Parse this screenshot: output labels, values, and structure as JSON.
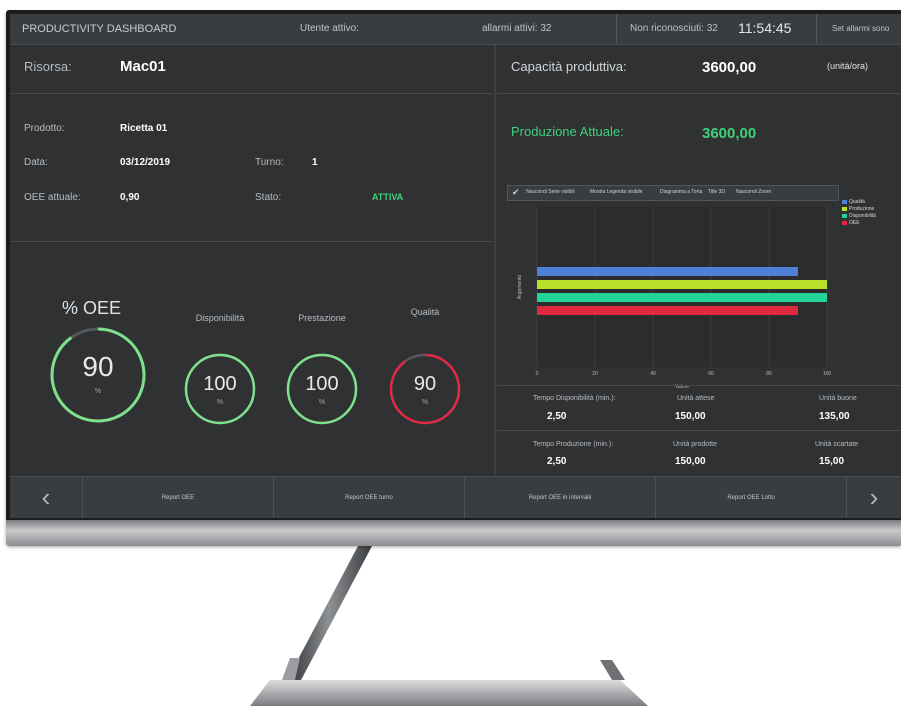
{
  "header": {
    "title": "PRODUCTIVITY DASHBOARD",
    "utente": "Utente attivo:",
    "allarmi": "allarmi attivi: 32",
    "non_riconosciuti": "Non riconosciuti: 32",
    "time": "11:54:45",
    "set": "Set allarmi sono"
  },
  "left": {
    "risorsa_label": "Risorsa:",
    "risorsa_value": "Mac01",
    "prodotto_label": "Prodotto:",
    "prodotto_value": "Ricetta 01",
    "data_label": "Data:",
    "data_value": "03/12/2019",
    "turno_label": "Turno:",
    "turno_value": "1",
    "oee_label": "OEE attuale:",
    "oee_value": "0,90",
    "stato_label": "Stato:",
    "stato_value": "ATTIVA"
  },
  "gauges": {
    "title": "% OEE",
    "oee": {
      "value": "90",
      "unit": "%",
      "fraction": 0.9
    },
    "disponibilita": {
      "label": "Disponibilità",
      "value": "100",
      "unit": "%",
      "fraction": 1.0
    },
    "prestazione": {
      "label": "Prestazione",
      "value": "100",
      "unit": "%",
      "fraction": 1.0
    },
    "qualita": {
      "label": "Qualità",
      "value": "90",
      "unit": "%",
      "fraction": 0.9
    }
  },
  "right": {
    "capacita_label": "Capacità produttiva:",
    "capacita_value": "3600,00",
    "capacita_unit": "(unità/ora)",
    "produzione_label": "Produzione Attuale:",
    "produzione_value": "3600,00",
    "toolbar": [
      "Nascondi Serie visibili",
      "Mostra Legenda visibile",
      "Diagramma a Torta",
      "Title 3D",
      "Nascondi Zoom"
    ],
    "tempo_disp_label": "Tempo Disponibilità (min.):",
    "tempo_disp_value": "2,50",
    "unita_attese_label": "Unità attese",
    "unita_attese_value": "150,00",
    "unita_buone_label": "Unità buone",
    "unita_buone_value": "135,00",
    "tempo_prod_label": "Tempo Produzione (min.):",
    "tempo_prod_value": "2,50",
    "unita_prodotte_label": "Unità prodotte",
    "unita_prodotte_value": "150,00",
    "unita_scartate_label": "Unità scartate",
    "unita_scartate_value": "15,00"
  },
  "chart_data": {
    "type": "bar",
    "orientation": "horizontal",
    "xlabel": "Valore",
    "ylabel": "Argomento",
    "xlim": [
      0,
      100
    ],
    "xticks": [
      "0",
      "20",
      "40",
      "60",
      "80",
      "100"
    ],
    "legend_placement": "top-right",
    "series": [
      {
        "name": "Qualità",
        "value": 90,
        "color": "#4f7fd6"
      },
      {
        "name": "Produzione",
        "value": 100,
        "color": "#b8e02a"
      },
      {
        "name": "Disponibilità",
        "value": 100,
        "color": "#22d39a"
      },
      {
        "name": "OEE",
        "value": 90,
        "color": "#e0283f"
      }
    ]
  },
  "nav": {
    "items": [
      "Report OEE",
      "Report OEE turno",
      "Report OEE in intervalli",
      "Report OEE Lotto"
    ]
  },
  "colors": {
    "gauge_green": "#7ee08a",
    "gauge_red": "#e02a45",
    "accent_green": "#3fd27a"
  }
}
